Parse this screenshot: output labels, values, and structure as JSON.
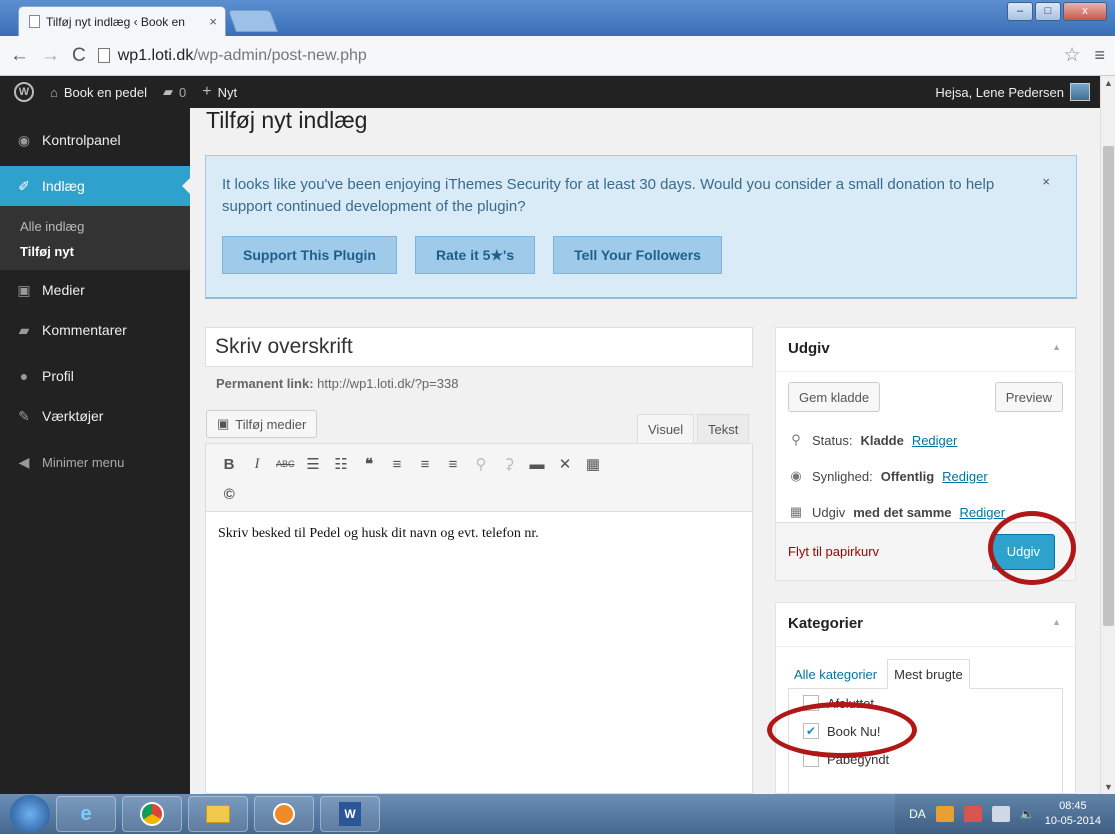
{
  "browser": {
    "tab_title": "Tilføj nyt indlæg ‹ Book en",
    "tab_close": "×",
    "window_buttons": [
      "–",
      "□",
      "x"
    ],
    "url_host": "wp1.loti.dk",
    "url_path": "/wp-admin/post-new.php"
  },
  "adminbar": {
    "site_name": "Book en pedel",
    "comments_count": "0",
    "new_label": "Nyt",
    "greeting": "Hejsa, Lene Pedersen"
  },
  "sidebar": {
    "items": [
      {
        "label": "Kontrolpanel",
        "icon": "dashboard-icon"
      },
      {
        "label": "Indlæg",
        "icon": "pin-icon"
      },
      {
        "label": "Medier",
        "icon": "media-icon"
      },
      {
        "label": "Kommentarer",
        "icon": "comment-icon"
      },
      {
        "label": "Profil",
        "icon": "user-icon"
      },
      {
        "label": "Værktøjer",
        "icon": "wrench-icon"
      }
    ],
    "sub_items": [
      "Alle indlæg",
      "Tilføj nyt"
    ],
    "minimize_label": "Minimer menu"
  },
  "page": {
    "title": "Tilføj nyt indlæg"
  },
  "notice": {
    "text": "It looks like you've been enjoying iThemes Security for at least 30 days. Would you consider a small donation to help support continued development of the plugin?",
    "dismiss": "×",
    "buttons": [
      "Support This Plugin",
      "Rate it 5★'s",
      "Tell Your Followers"
    ]
  },
  "editor": {
    "title_placeholder": "Skriv overskrift",
    "permalink_label": "Permanent link:",
    "permalink_url": "http://wp1.loti.dk/?p=338",
    "add_media": "Tilføj medier",
    "tab_visual": "Visuel",
    "tab_text": "Tekst",
    "bold": "B",
    "italic": "I",
    "body": "Skriv besked til Pedel og husk dit navn og evt. telefon nr."
  },
  "publish": {
    "heading": "Udgiv",
    "save_draft": "Gem kladde",
    "preview": "Preview",
    "status_label": "Status:",
    "status_value": "Kladde",
    "visibility_label": "Synlighed:",
    "visibility_value": "Offentlig",
    "publish_label": "Udgiv",
    "publish_value": "med det samme",
    "edit_link": "Rediger",
    "trash": "Flyt til papirkurv",
    "publish_button": "Udgiv"
  },
  "categories": {
    "heading": "Kategorier",
    "tab_all": "Alle kategorier",
    "tab_most_used": "Mest brugte",
    "items": [
      {
        "label": "Afsluttet",
        "checked": false
      },
      {
        "label": "Book Nu!",
        "checked": true
      },
      {
        "label": "Påbegyndt",
        "checked": false
      }
    ]
  },
  "taskbar": {
    "language": "DA",
    "time": "08:45",
    "date": "10-05-2014"
  },
  "colors": {
    "accent": "#2ea2cc",
    "annotation_ring": "#b01717",
    "adminbar_bg": "#222222"
  }
}
